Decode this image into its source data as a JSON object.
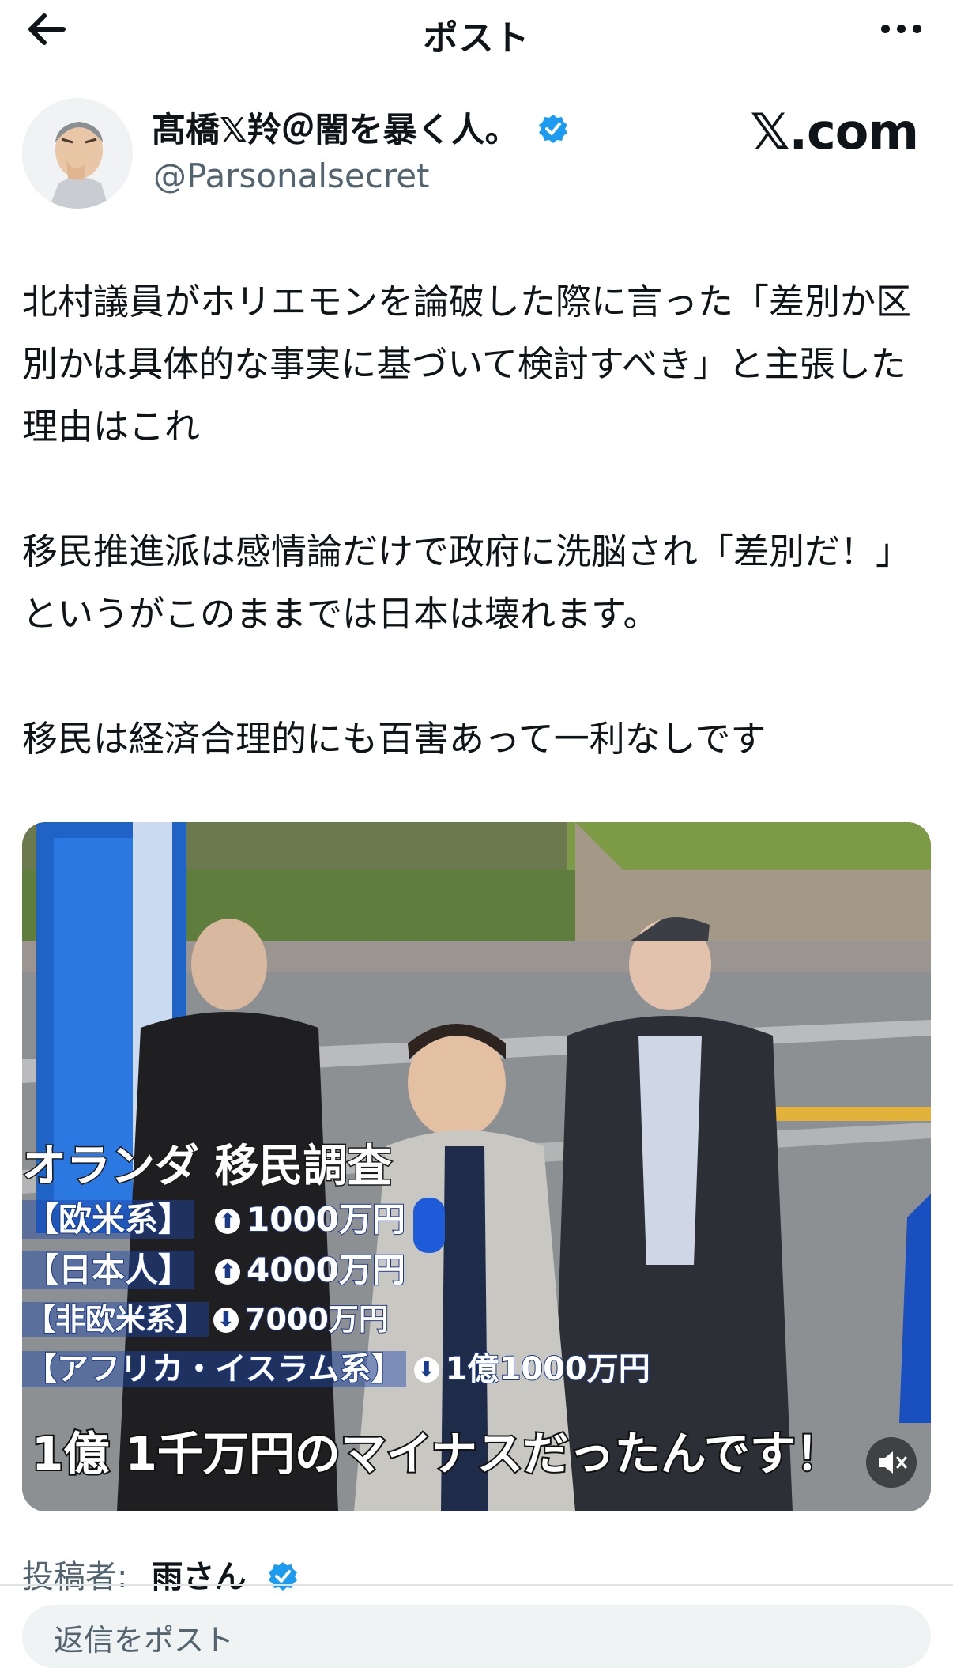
{
  "header": {
    "title": "ポスト"
  },
  "author": {
    "display_name": "髙橋𝕏羚＠闇を暴く人。",
    "handle": "@Parsonalsecret",
    "watermark": "𝕏.com"
  },
  "post": {
    "text": "北村議員がホリエモンを論破した際に言った「差別か区別かは具体的な事実に基づいて検討すべき」と主張した理由はこれ\n\n移民推進派は感情論だけで政府に洗脳され「差別だ！」というがこのままでは日本は壊れます。\n\n移民は経済合理的にも百害あって一利なしです"
  },
  "media": {
    "caption_title": "オランダ 移民調査",
    "rows": [
      {
        "label": "【欧米系】",
        "arrow": "⬆",
        "value": "1000万円"
      },
      {
        "label": "【日本人】",
        "arrow": "⬆",
        "value": "4000万円"
      },
      {
        "label": "【非欧米系】",
        "arrow": "⬇",
        "value": "7000万円"
      },
      {
        "label": "【アフリカ・イスラム系】",
        "arrow": "⬇",
        "value": "1億1000万円"
      }
    ],
    "caption_bottom": "1億 1千万円のマイナスだったんです！"
  },
  "footer": {
    "poster_label": "投稿者:",
    "poster_name": "雨さん",
    "reply_placeholder": "返信をポスト"
  },
  "colors": {
    "verified": "#1d9bf0",
    "muted_text": "#536471",
    "caption_blue": "#1a3a8a"
  }
}
